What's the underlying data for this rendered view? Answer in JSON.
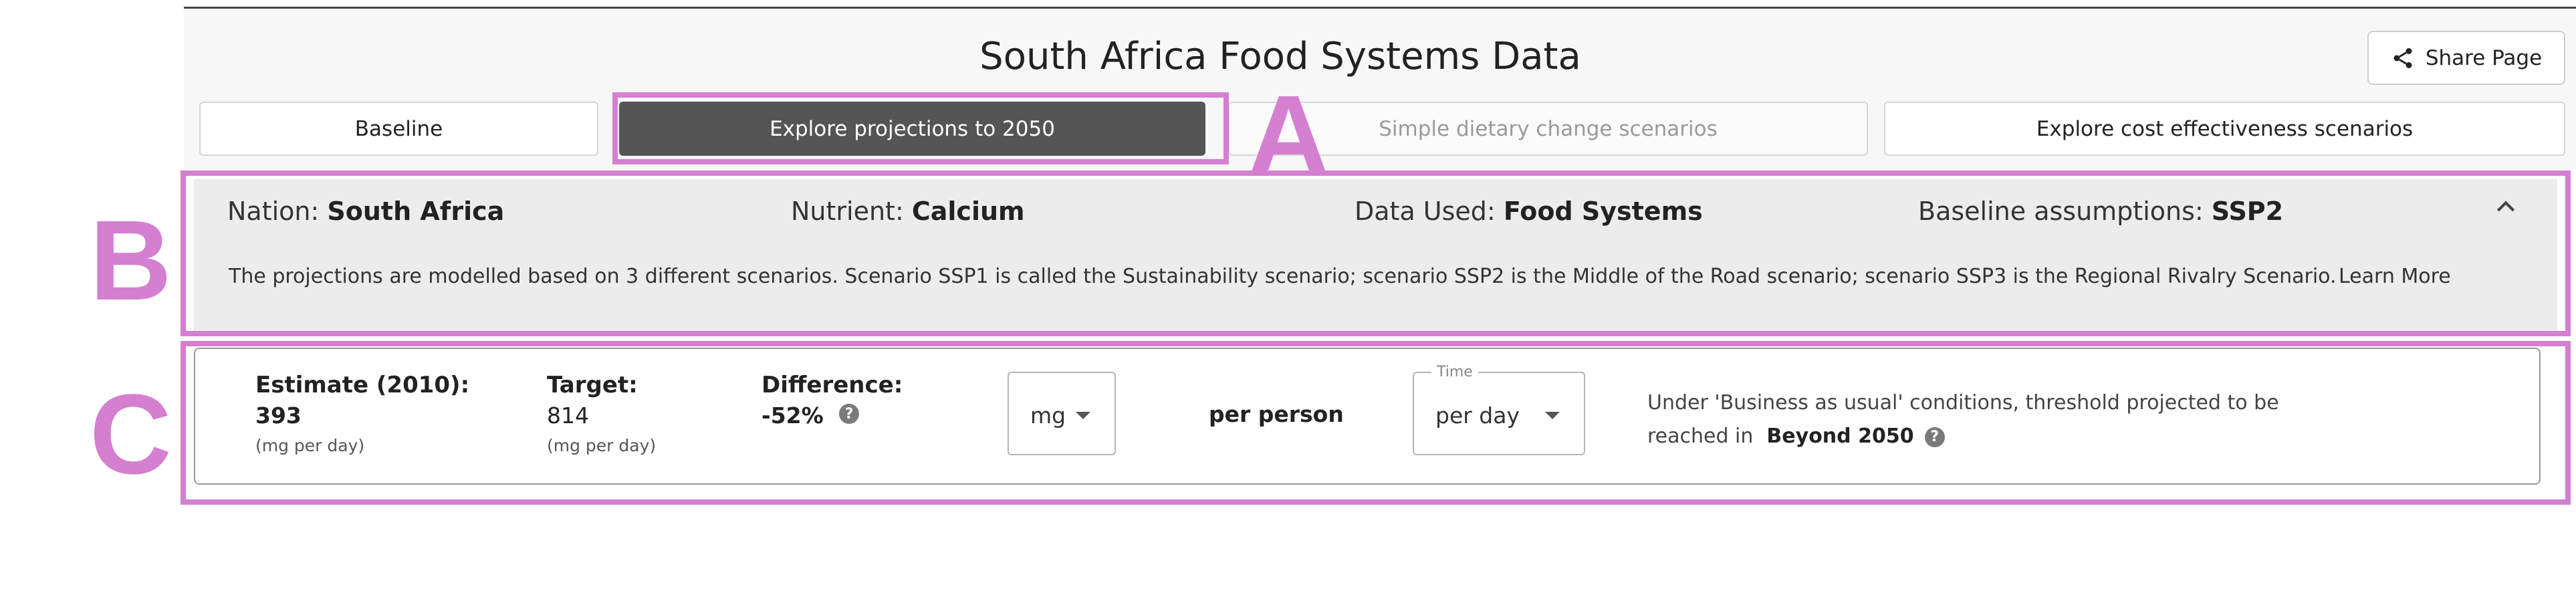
{
  "header": {
    "title": "South Africa Food Systems Data",
    "share_label": "Share Page"
  },
  "tabs": [
    {
      "label": "Baseline",
      "state": "normal"
    },
    {
      "label": "Explore projections to 2050",
      "state": "active"
    },
    {
      "label": "Simple dietary change scenarios",
      "state": "disabled"
    },
    {
      "label": "Explore cost effectiveness scenarios",
      "state": "normal"
    }
  ],
  "assumptions": {
    "nation_label": "Nation:",
    "nation_value": "South Africa",
    "nutrient_label": "Nutrient:",
    "nutrient_value": "Calcium",
    "data_label": "Data Used:",
    "data_value": "Food Systems",
    "baseline_label": "Baseline assumptions:",
    "baseline_value": "SSP2",
    "description": "The projections are modelled based on 3 different scenarios. Scenario SSP1 is called the Sustainability scenario; scenario SSP2 is the Middle of the Road scenario; scenario SSP3 is the Regional Rivalry Scenario.",
    "learn_more": "Learn More"
  },
  "stats": {
    "estimate_label": "Estimate (2010):",
    "estimate_value": "393",
    "estimate_unit": "(mg per day)",
    "target_label": "Target:",
    "target_value": "814",
    "target_unit": "(mg per day)",
    "difference_label": "Difference:",
    "difference_value": "-52%",
    "unit_select": "mg",
    "per_label": "per person",
    "time_legend": "Time",
    "time_select": "per day",
    "bau_line1": "Under 'Business as usual' conditions, threshold projected to be",
    "bau_line2_prefix": "reached in",
    "bau_value": "Beyond 2050"
  },
  "annotations": {
    "a": "A",
    "b": "B",
    "c": "C"
  },
  "colors": {
    "highlight": "#d47fd0",
    "active_tab": "#555555",
    "panel_bg": "#ececec"
  }
}
